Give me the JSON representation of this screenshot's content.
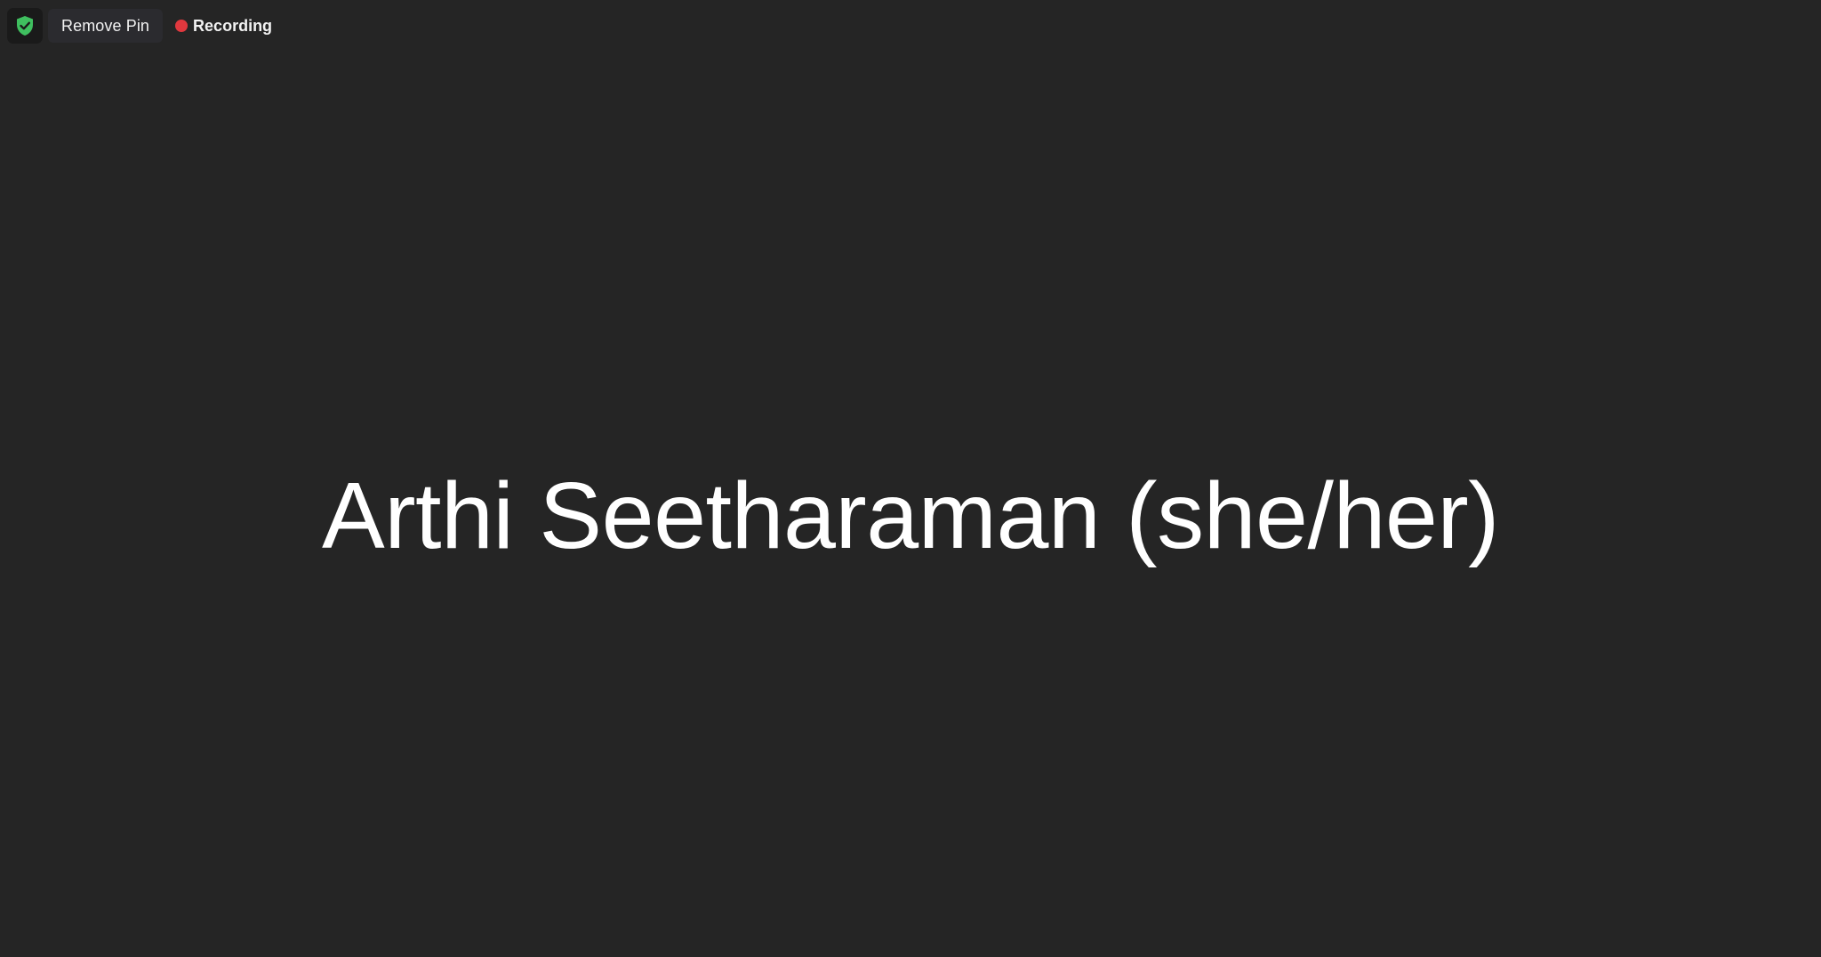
{
  "topbar": {
    "security_icon": "shield-check-icon",
    "security_color": "#3fbf5f",
    "remove_pin_label": "Remove Pin",
    "recording_label": "Recording",
    "recording_color": "#e0383e"
  },
  "main": {
    "participant_name": "Arthi Seetharaman (she/her)"
  },
  "colors": {
    "background": "#252525",
    "text": "#ffffff"
  }
}
